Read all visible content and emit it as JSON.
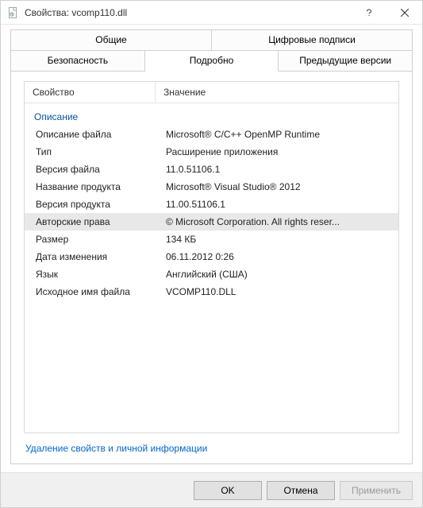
{
  "titlebar": {
    "title": "Свойства: vcomp110.dll"
  },
  "tabs": {
    "row1": [
      {
        "label": "Общие"
      },
      {
        "label": "Цифровые подписи"
      }
    ],
    "row2": [
      {
        "label": "Безопасность"
      },
      {
        "label": "Подробно",
        "active": true
      },
      {
        "label": "Предыдущие версии"
      }
    ]
  },
  "columns": {
    "name": "Свойство",
    "value": "Значение"
  },
  "group": {
    "title": "Описание"
  },
  "props": [
    {
      "name": "Описание файла",
      "value": "Microsoft® C/C++ OpenMP Runtime"
    },
    {
      "name": "Тип",
      "value": "Расширение приложения"
    },
    {
      "name": "Версия файла",
      "value": "11.0.51106.1"
    },
    {
      "name": "Название продукта",
      "value": "Microsoft® Visual Studio® 2012"
    },
    {
      "name": "Версия продукта",
      "value": "11.00.51106.1"
    },
    {
      "name": "Авторские права",
      "value": "© Microsoft Corporation. All rights reser...",
      "selected": true
    },
    {
      "name": "Размер",
      "value": "134 КБ"
    },
    {
      "name": "Дата изменения",
      "value": "06.11.2012 0:26"
    },
    {
      "name": "Язык",
      "value": "Английский (США)"
    },
    {
      "name": "Исходное имя файла",
      "value": "VCOMP110.DLL"
    }
  ],
  "link": {
    "label": "Удаление свойств и личной информации"
  },
  "buttons": {
    "ok": "OK",
    "cancel": "Отмена",
    "apply": "Применить"
  }
}
